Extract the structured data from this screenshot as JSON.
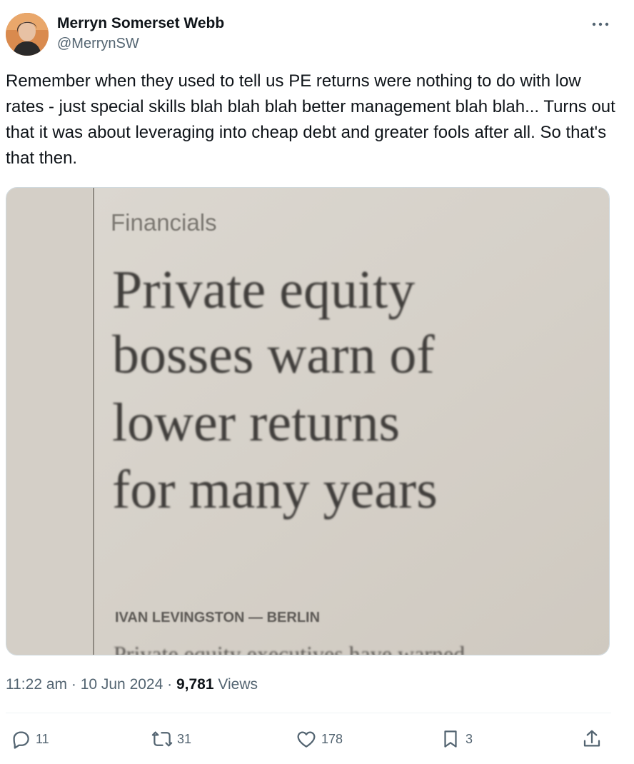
{
  "author": {
    "display_name": "Merryn Somerset Webb",
    "handle": "@MerrynSW",
    "avatar_icon": "profile-photo"
  },
  "tweet": {
    "text": "Remember when they used to tell us PE returns were nothing to do with low rates - just special skills blah blah blah better management blah blah... Turns out that it was about leveraging into cheap debt and greater fools after all. So that's that then."
  },
  "media": {
    "section": "Financials",
    "headline_lines": [
      "Private equity",
      "bosses warn of",
      "lower returns",
      "for many years"
    ],
    "byline": "IVAN LEVINGSTON — BERLIN",
    "partial_line": "Private equity executives have warned"
  },
  "meta": {
    "time": "11:22 am",
    "separator": "·",
    "date": "10 Jun 2024",
    "views_count": "9,781",
    "views_label": "Views"
  },
  "actions": {
    "replies": "11",
    "reposts": "31",
    "likes": "178",
    "bookmarks": "3"
  },
  "colors": {
    "secondary_text": "#536471",
    "primary_text": "#0f1419",
    "newsprint": "#d9d4cc"
  }
}
